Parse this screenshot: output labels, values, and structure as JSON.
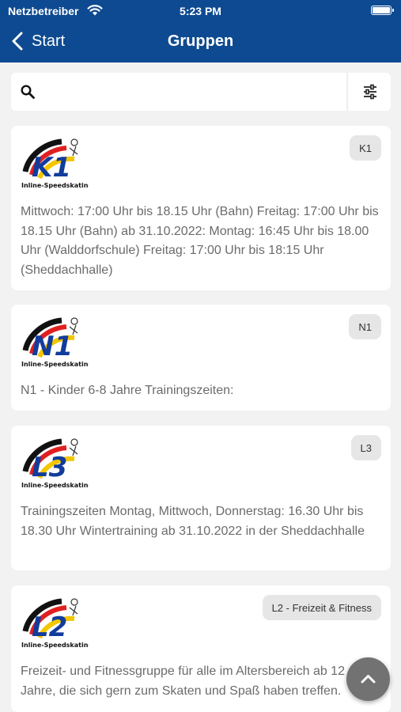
{
  "status_bar": {
    "carrier": "Netzbetreiber",
    "time": "5:23 PM"
  },
  "nav": {
    "back_label": "Start",
    "title": "Gruppen"
  },
  "search": {
    "value": "",
    "placeholder": ""
  },
  "groups": [
    {
      "logo_text": "K1",
      "logo_caption": "Inline-Speedskating",
      "badge": "K1",
      "description": "Mittwoch: 17:00 Uhr bis 18.15 Uhr (Bahn) Freitag: 17:00 Uhr bis 18.15 Uhr (Bahn) ab 31.10.2022: Montag: 16:45 Uhr bis 18.00 Uhr (Walddorfschule) Freitag: 17:00 Uhr bis 18:15 Uhr (Sheddachhalle)"
    },
    {
      "logo_text": "N1",
      "logo_caption": "Inline-Speedskating",
      "badge": "N1",
      "description": "N1 - Kinder 6-8 Jahre Trainingszeiten:"
    },
    {
      "logo_text": "L3",
      "logo_caption": "Inline-Speedskating",
      "badge": "L3",
      "description": "Trainingszeiten Montag, Mittwoch, Donnerstag: 16.30 Uhr bis 18.30 Uhr Wintertraining ab 31.10.2022 in der Sheddachhalle"
    },
    {
      "logo_text": "L2",
      "logo_caption": "Inline-Speedskating",
      "badge": "L2 - Freizeit & Fitness",
      "description": "Freizeit- und Fitnessgruppe für alle im Altersbereich ab 12 Jahre, die sich gern zum Skaten und Spaß haben treffen."
    }
  ],
  "icons": {
    "wifi": "wifi-icon",
    "battery": "battery-icon",
    "back": "chevron-left-icon",
    "search": "search-icon",
    "filter": "sliders-icon",
    "scroll_top": "chevron-up-icon"
  },
  "colors": {
    "header": "#0e4a91",
    "background": "#f2f2f2",
    "badge": "#e6e6e6",
    "text": "#6b6b6b",
    "fab": "#727272"
  }
}
